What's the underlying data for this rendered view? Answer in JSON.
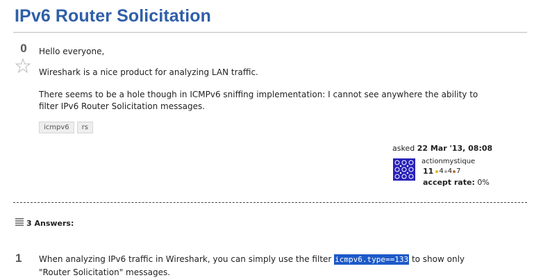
{
  "question": {
    "title": "IPv6 Router Solicitation",
    "votes": "0",
    "paragraphs": [
      "Hello everyone,",
      "Wireshark is a nice product for analyzing LAN traffic.",
      "There seems to be a hole though in ICMPv6 sniffing implementation: I cannot see anywhere the ability to filter IPv6 Router Solicitation messages."
    ],
    "tags": [
      "icmpv6",
      "rs"
    ],
    "asked_label": "asked",
    "asked_date": "22 Mar '13, 08:08",
    "user": {
      "name": "actionmystique",
      "rep": "11",
      "badges": [
        {
          "count": "4",
          "color": "#e6b800"
        },
        {
          "count": "4",
          "color": "#a8a8a8"
        },
        {
          "count": "7",
          "color": "#b87333"
        }
      ],
      "accept_label": "accept rate:",
      "accept_value": "0%"
    }
  },
  "answers": {
    "count_label": "3 Answers:",
    "items": [
      {
        "votes": "1",
        "text_before": "When analyzing IPv6 traffic in Wireshark, you can simply use the filter ",
        "code": "icmpv6.type==133",
        "text_after": " to show only \"Router Solicitation\" messages."
      }
    ]
  }
}
